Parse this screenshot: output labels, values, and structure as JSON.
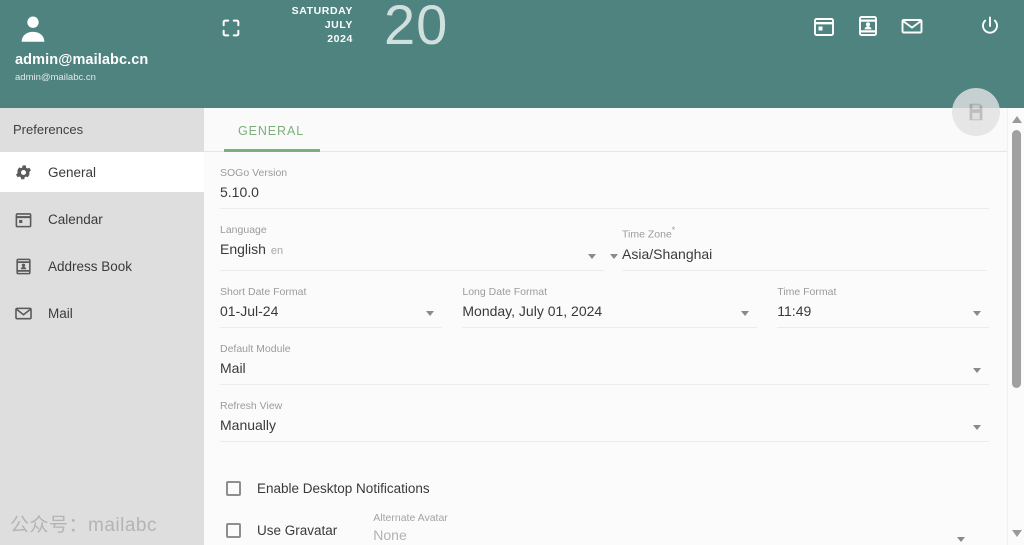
{
  "sidebar": {
    "user": {
      "avatar_icon": "person-icon",
      "primary": "admin@mailabc.cn",
      "secondary": "admin@mailabc.cn"
    },
    "section_label": "Preferences",
    "items": [
      {
        "label": "General",
        "icon": "gear-icon",
        "active": true
      },
      {
        "label": "Calendar",
        "icon": "calendar-icon",
        "active": false
      },
      {
        "label": "Address Book",
        "icon": "address-book-icon",
        "active": false
      },
      {
        "label": "Mail",
        "icon": "mail-icon",
        "active": false
      }
    ],
    "watermark": "公众号：mailabc"
  },
  "topbar": {
    "expand_icon": "fullscreen-icon",
    "date": {
      "weekday": "SATURDAY",
      "month": "JULY",
      "year": "2024",
      "day": "20"
    },
    "actions": [
      {
        "icon": "calendar-icon"
      },
      {
        "icon": "address-book-icon"
      },
      {
        "icon": "mail-icon"
      },
      {
        "icon": "power-icon"
      }
    ],
    "save_fab_icon": "save-floppy-icon",
    "accent_color": "#4e8380"
  },
  "main": {
    "tabs": [
      {
        "label": "GENERAL",
        "active": true
      }
    ],
    "tab_accent_color": "#7daf7d",
    "fields": {
      "sogo_version": {
        "label": "SOGo Version",
        "value": "5.10.0"
      },
      "language": {
        "label": "Language",
        "value": "English",
        "sub": "en"
      },
      "time_zone": {
        "label": "Time Zone",
        "required_mark": "*",
        "value": "Asia/Shanghai"
      },
      "short_date_format": {
        "label": "Short Date Format",
        "value": "01-Jul-24"
      },
      "long_date_format": {
        "label": "Long Date Format",
        "value": "Monday, July 01, 2024"
      },
      "time_format": {
        "label": "Time Format",
        "value": "11:49"
      },
      "default_module": {
        "label": "Default Module",
        "value": "Mail"
      },
      "refresh_view": {
        "label": "Refresh View",
        "value": "Manually"
      },
      "alternate_avatar": {
        "label": "Alternate Avatar",
        "value": "None"
      }
    },
    "checkboxes": [
      {
        "label": "Enable Desktop Notifications",
        "checked": false
      },
      {
        "label": "Use Gravatar",
        "checked": false
      }
    ]
  },
  "scrollbar": {
    "up_icon": "triangle-up-icon",
    "down_icon": "triangle-down-icon"
  }
}
